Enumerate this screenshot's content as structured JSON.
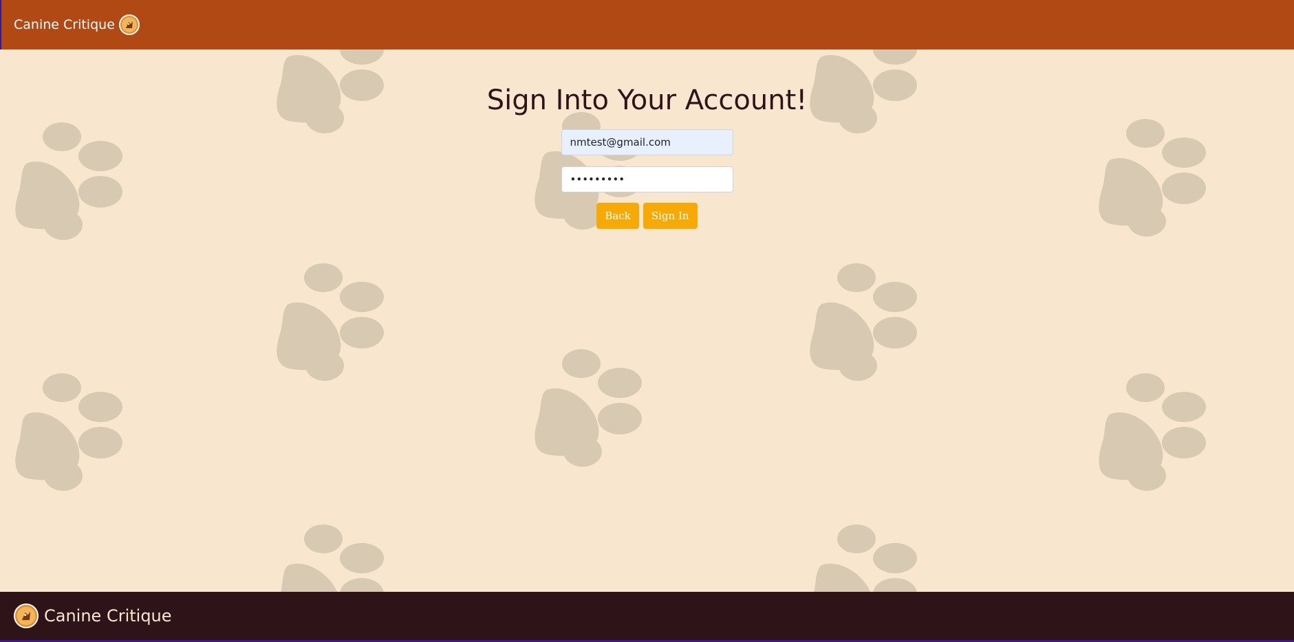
{
  "navbar": {
    "brand_text": "Canine Critique",
    "logo_icon": "dog-logo-icon",
    "background_color": "#b14915"
  },
  "page": {
    "title": "Sign Into Your Account!",
    "background_color": "#f8e6cf",
    "paw_color": "#d8cab2"
  },
  "form": {
    "email_value": "nmtest@gmail.com",
    "password_value": "•••••••••",
    "back_label": "Back",
    "signin_label": "Sign In",
    "button_color": "#f7aa05"
  },
  "footer": {
    "brand_text": "Canine Critique",
    "logo_icon": "dog-logo-icon",
    "background_color": "#2e1418"
  }
}
